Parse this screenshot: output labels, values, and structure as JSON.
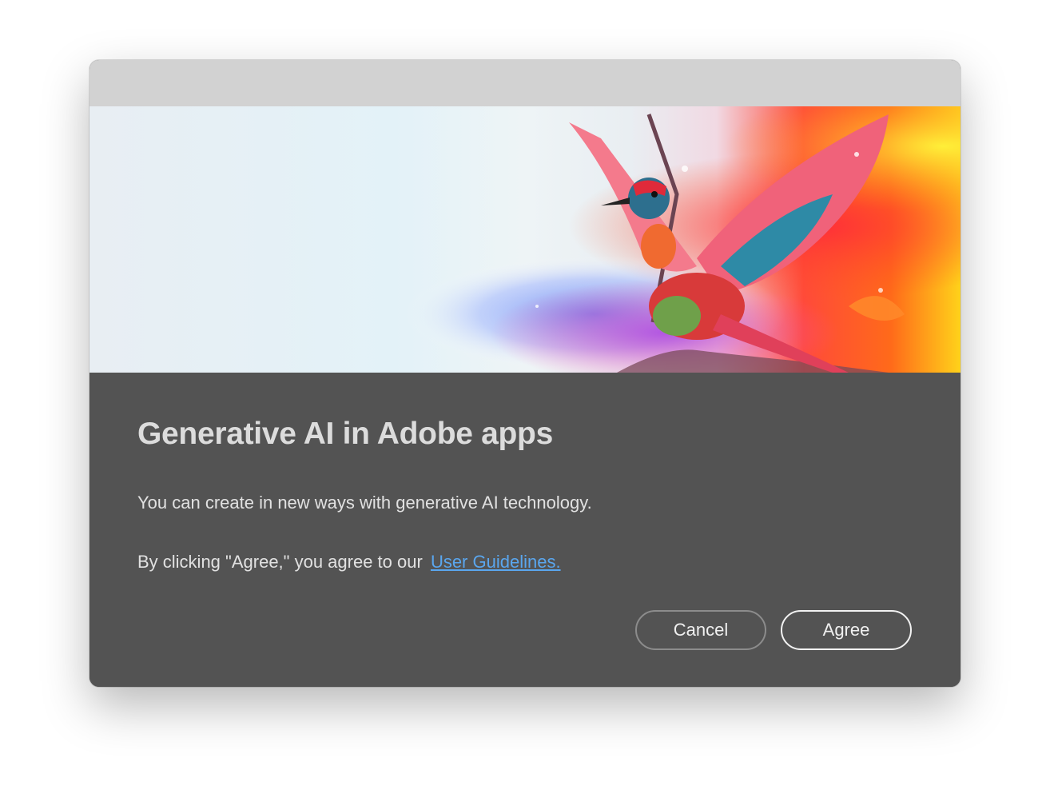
{
  "dialog": {
    "title": "Generative AI in Adobe apps",
    "description": "You can create in new ways with generative AI technology.",
    "agreement_prefix": "By clicking \"Agree,\" you agree to our",
    "guidelines_link": "User Guidelines.",
    "buttons": {
      "cancel_label": "Cancel",
      "agree_label": "Agree"
    }
  },
  "hero_image": {
    "subject": "colorful-bird-illustration"
  },
  "colors": {
    "dialog_background": "#535353",
    "titlebar": "#d2d2d2",
    "link": "#5aa6ee",
    "title_text": "#dcdcdc"
  }
}
